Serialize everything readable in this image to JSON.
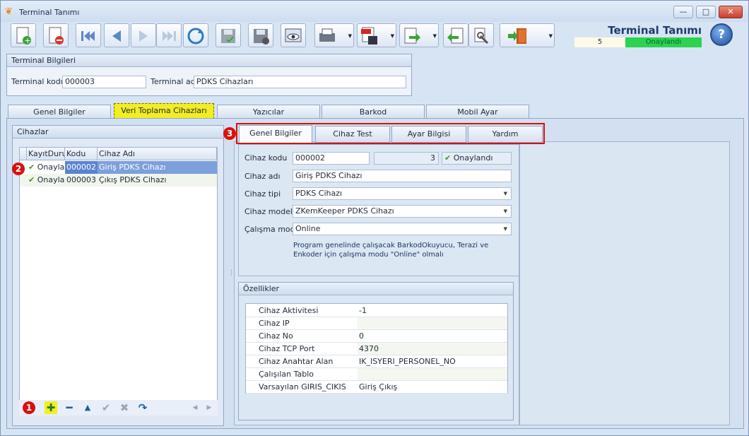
{
  "window": {
    "title": "Terminal Tanımı",
    "min": "—",
    "max": "□",
    "close": "✕"
  },
  "header": {
    "title": "Terminal Tanımı",
    "count": "5",
    "status": "Onaylandı",
    "help": "?"
  },
  "terminal_info": {
    "title": "Terminal Bilgileri",
    "code_label": "Terminal kodu",
    "code_value": "000003",
    "name_label": "Terminal adı",
    "name_value": "PDKS Cihazları"
  },
  "main_tabs": [
    "Genel Bilgiler",
    "Veri Toplama Cihazları",
    "Yazıcılar",
    "Barkod",
    "Mobil Ayar"
  ],
  "devices": {
    "title": "Cihazlar",
    "columns": [
      "KayıtDurumu",
      "Kodu",
      "Cihaz Adı"
    ],
    "rows": [
      {
        "status": "Onaylandı",
        "code": "000002",
        "name": "Giriş PDKS Cihazı"
      },
      {
        "status": "Onaylandı",
        "code": "000003",
        "name": "Çıkış PDKS Cihazı"
      }
    ]
  },
  "badges": [
    "1",
    "2",
    "3"
  ],
  "inner_tabs": [
    "Genel Bilgiler",
    "Cihaz Test",
    "Ayar Bilgisi",
    "Yardım"
  ],
  "genel": {
    "code_label": "Cihaz kodu",
    "code_value": "000002",
    "code_num": "3",
    "status": "Onaylandı",
    "name_label": "Cihaz adı",
    "name_value": "Giriş PDKS Cihazı",
    "type_label": "Cihaz tipi",
    "type_value": "PDKS Cihazı",
    "model_label": "Cihaz modeli",
    "model_value": "ZKemKeeper PDKS Cihazı",
    "mode_label": "Çalışma modu",
    "mode_value": "Online",
    "note": "Program genelinde çalışacak BarkodOkuyucu, Terazi ve Enkoder için çalışma modu \"Online\" olmalı"
  },
  "properties": {
    "title": "Özellikler",
    "rows": [
      {
        "key": "Cihaz Aktivitesi",
        "value": "-1"
      },
      {
        "key": "Cihaz IP",
        "value": ""
      },
      {
        "key": "Cihaz No",
        "value": "0"
      },
      {
        "key": "Cihaz TCP Port",
        "value": "4370"
      },
      {
        "key": "Cihaz Anahtar Alan",
        "value": "IK_ISYERI_PERSONEL_NO"
      },
      {
        "key": "Çalışılan Tablo",
        "value": ""
      },
      {
        "key": "Varsayılan GIRIS_CIKIS",
        "value": "Giriş Çıkış"
      }
    ]
  },
  "colors": {
    "accent": "#f2ee22",
    "status": "#2bd34e",
    "badge": "#d9100c"
  }
}
